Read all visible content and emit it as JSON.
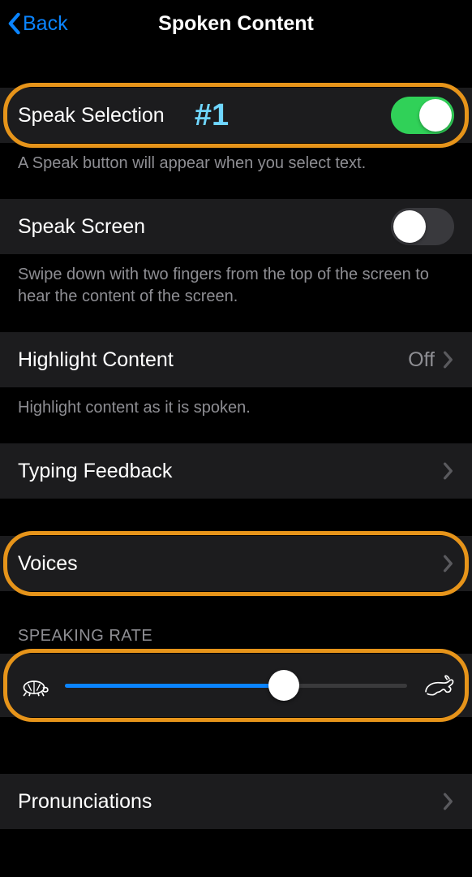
{
  "nav": {
    "back_label": "Back",
    "title": "Spoken Content"
  },
  "annotation_label": "#1",
  "sections": {
    "speak_selection": {
      "label": "Speak Selection",
      "footer": "A Speak button will appear when you select text.",
      "value_on": true
    },
    "speak_screen": {
      "label": "Speak Screen",
      "footer": "Swipe down with two fingers from the top of the screen to hear the content of the screen.",
      "value_on": false
    },
    "highlight_content": {
      "label": "Highlight Content",
      "value": "Off",
      "footer": "Highlight content as it is spoken."
    },
    "typing_feedback": {
      "label": "Typing Feedback"
    },
    "voices": {
      "label": "Voices"
    },
    "speaking_rate": {
      "header": "SPEAKING RATE",
      "value_percent": 64
    },
    "pronunciations": {
      "label": "Pronunciations"
    }
  },
  "colors": {
    "accent": "#0a84ff",
    "highlight_ring": "#e6941a",
    "toggle_on": "#30d158"
  }
}
